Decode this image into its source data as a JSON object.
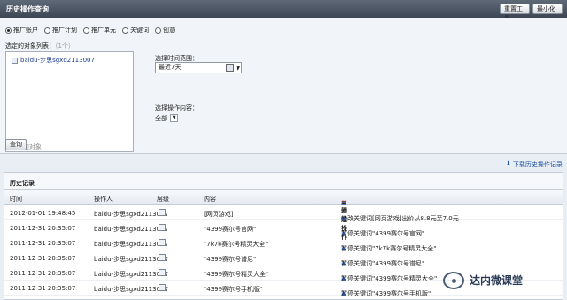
{
  "header": {
    "title": "历史操作查询",
    "reset_button": "重置工具",
    "minimize_button": "最小化"
  },
  "scope": {
    "options": [
      "推广账户",
      "推广计划",
      "推广单元",
      "关键词",
      "创意"
    ],
    "selected_index": 0
  },
  "objects": {
    "label": "选定的对象列表：",
    "hint": "（1个）",
    "items": [
      "baidu-步思sgxd2113007"
    ],
    "add_link": "+添加对象"
  },
  "time_range": {
    "label": "选择时间范围：",
    "value": "最近7天"
  },
  "operation": {
    "label": "选择操作内容：",
    "value": "全部"
  },
  "query_button": "查询",
  "download_link": "下载历史操作记录",
  "history": {
    "title": "历史记录",
    "columns": {
      "time": "时间",
      "operator": "操作人",
      "level": "层级",
      "content": "内容"
    },
    "legend": {
      "modify": "= 修改操作",
      "add": "= 添加操作",
      "delete": "= 删除操作"
    },
    "rows": [
      {
        "time": "2012-01-01 19:48:45",
        "operator": "baidu-步思sgxd2113007",
        "content": "[网页游戏]",
        "action": "修改关键词[网页游戏]出价从8.8元至7.0元"
      },
      {
        "time": "2011-12-31 20:35:07",
        "operator": "baidu-步思sgxd2113007",
        "content": "\"4399赛尔号官网\"",
        "action": "暂停关键词\"4399赛尔号官网\""
      },
      {
        "time": "2011-12-31 20:35:07",
        "operator": "baidu-步思sgxd2113007",
        "content": "\"7k7k赛尔号精灵大全\"",
        "action": "暂停关键词\"7k7k赛尔号精灵大全\""
      },
      {
        "time": "2011-12-31 20:35:07",
        "operator": "baidu-步思sgxd2113007",
        "content": "\"4399赛尔号谱尼\"",
        "action": "暂停关键词\"4399赛尔号谱尼\""
      },
      {
        "time": "2011-12-31 20:35:07",
        "operator": "baidu-步思sgxd2113007",
        "content": "\"4399赛尔号精灵大全\"",
        "action": "暂停关键词\"4399赛尔号精灵大全\""
      },
      {
        "time": "2011-12-31 20:35:07",
        "operator": "baidu-步思sgxd2113007",
        "content": "\"4399赛尔号手机版\"",
        "action": "暂停关键词\"4399赛尔号手机版\""
      }
    ]
  },
  "watermark": "达内微课堂"
}
